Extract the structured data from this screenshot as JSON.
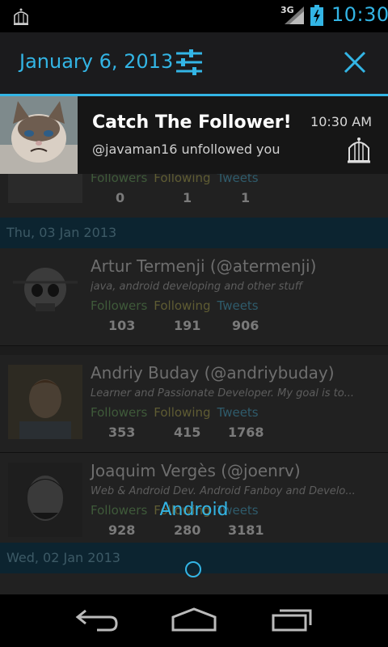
{
  "status_bar": {
    "network": "3G",
    "time": "10:30",
    "accent_color": "#33b5e5"
  },
  "notification_header": {
    "date": "January 6, 2013",
    "settings_icon": "sliders-icon",
    "close_icon": "close-icon"
  },
  "notification": {
    "title": "Catch The Follower!",
    "message": "@javaman16 unfollowed you",
    "time": "10:30 AM",
    "app_icon": "birdcage-icon"
  },
  "list": {
    "top_row": {
      "labels": [
        "Followers",
        "Following",
        "Tweets"
      ],
      "values": [
        "0",
        "1",
        "1"
      ]
    },
    "sections": [
      {
        "header": "Thu, 03 Jan 2013",
        "rows": [
          {
            "name": "Artur Termenji (@atermenji)",
            "bio": "java, android developing and other stuff",
            "labels": [
              "Followers",
              "Following",
              "Tweets"
            ],
            "values": [
              "103",
              "191",
              "906"
            ]
          },
          {
            "name": "Andriy Buday (@andriybuday)",
            "bio": "Learner and Passionate Developer. My goal is to...",
            "labels": [
              "Followers",
              "Following",
              "Tweets"
            ],
            "values": [
              "353",
              "415",
              "1768"
            ]
          },
          {
            "name": "Joaquim Vergès (@joenrv)",
            "bio": "Web & Android Dev. Android Fanboy and Develo...",
            "labels": [
              "Followers",
              "Following",
              "Tweets"
            ],
            "values": [
              "928",
              "280",
              "3181"
            ]
          }
        ]
      },
      {
        "header": "Wed, 02 Jan 2013"
      }
    ]
  },
  "overlay_label": "Android",
  "navbar": {
    "back": "back-icon",
    "home": "home-icon",
    "recents": "recents-icon"
  }
}
